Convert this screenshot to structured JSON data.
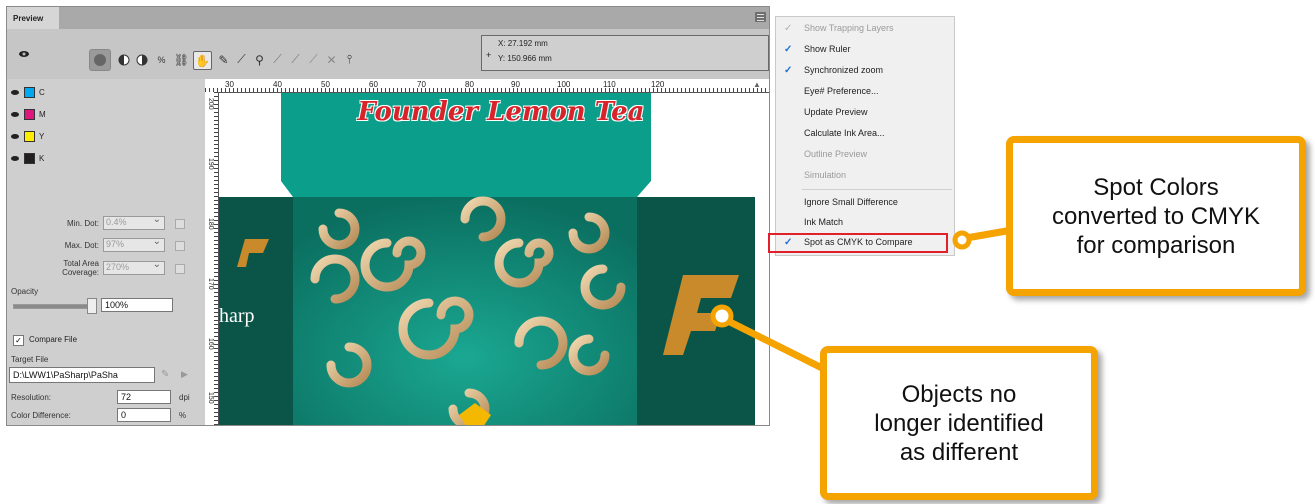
{
  "preview": {
    "tab_label": "Preview",
    "coordinates": {
      "x": "X: 27.192 mm",
      "y": "Y: 150.966 mm"
    }
  },
  "separations": [
    {
      "label": "C",
      "color": "#00a9ef"
    },
    {
      "label": "M",
      "color": "#e0167f"
    },
    {
      "label": "Y",
      "color": "#ffed00"
    },
    {
      "label": "K",
      "color": "#231f20"
    }
  ],
  "dot_settings": {
    "min_dot_label": "Min. Dot:",
    "min_dot_value": "0.4%",
    "max_dot_label": "Max. Dot:",
    "max_dot_value": "97%",
    "coverage_label_1": "Total Area",
    "coverage_label_2": "Coverage:",
    "coverage_value": "270%",
    "opacity_label": "Opacity",
    "opacity_value": "100%",
    "opacity_level": 1.0
  },
  "compare": {
    "checkbox_label": "Compare File",
    "checked": true,
    "target_file_label": "Target File",
    "target_file_value": "D:\\LWW1\\PaSharp\\PaSha",
    "resolution_label": "Resolution:",
    "resolution_value": "72",
    "resolution_unit": "dpi",
    "color_diff_label": "Color Difference:",
    "color_diff_value": "0",
    "color_diff_unit": "%"
  },
  "ruler": {
    "h_ticks": [
      "30",
      "40",
      "50",
      "60",
      "70",
      "80",
      "90",
      "100",
      "110",
      "120"
    ],
    "v_ticks": [
      "200",
      "190",
      "180",
      "170",
      "160",
      "150"
    ]
  },
  "artwork": {
    "title": "Founder Lemon Tea",
    "side_text": "harp",
    "teal": "#0b9e8a",
    "dark_teal": "#0b5548",
    "gold": "#c8a06a"
  },
  "menu": {
    "items": [
      {
        "label": "Show Trapping Layers",
        "checked": true,
        "disabled": true
      },
      {
        "label": "Show Ruler",
        "checked": true,
        "disabled": false
      },
      {
        "label": "Synchronized zoom",
        "checked": true,
        "disabled": false
      },
      {
        "label": "Eye# Preference...",
        "checked": false,
        "disabled": false
      },
      {
        "label": "Update Preview",
        "checked": false,
        "disabled": false
      },
      {
        "label": "Calculate Ink Area...",
        "checked": false,
        "disabled": false
      },
      {
        "label": "Outline Preview",
        "checked": false,
        "disabled": true
      },
      {
        "label": "Simulation",
        "checked": false,
        "disabled": true
      },
      {
        "label": "Ignore Small Difference",
        "checked": false,
        "disabled": false
      },
      {
        "label": "Ink Match",
        "checked": false,
        "disabled": false
      },
      {
        "label": "Spot as CMYK to Compare",
        "checked": true,
        "disabled": false
      }
    ],
    "highlight_color": "#e0202a"
  },
  "callouts": {
    "spot": [
      "Spot Colors",
      "converted to CMYK",
      "for comparison"
    ],
    "objects": [
      "Objects no",
      "longer identified",
      "as different"
    ],
    "border_color": "#f5a300"
  }
}
